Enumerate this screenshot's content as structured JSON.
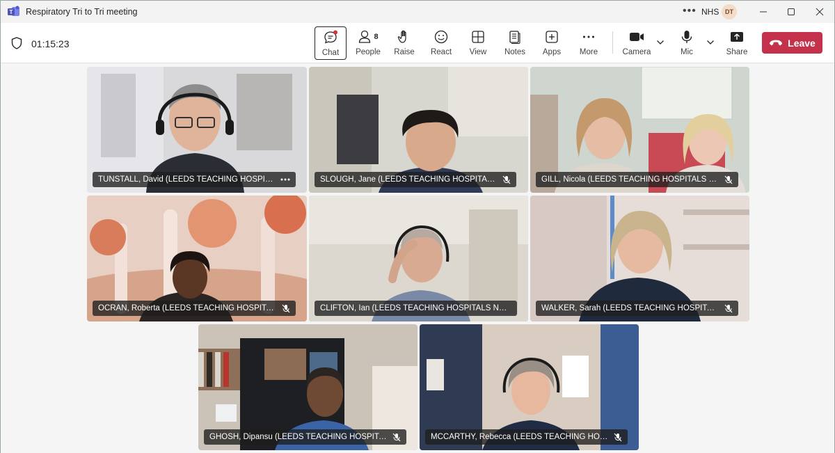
{
  "window": {
    "title": "Respiratory Tri to Tri meeting",
    "org": "NHS",
    "avatar_initials": "DT",
    "more": "•••"
  },
  "toolbar": {
    "timer": "01:15:23",
    "chat": "Chat",
    "people": "People",
    "people_count": "8",
    "raise": "Raise",
    "react": "React",
    "view": "View",
    "notes": "Notes",
    "apps": "Apps",
    "more": "More",
    "camera": "Camera",
    "mic": "Mic",
    "share": "Share",
    "leave": "Leave"
  },
  "colors": {
    "accent": "#5b5fc7",
    "leave": "#c4314b",
    "chat_badge": "#d13438"
  },
  "participants": [
    {
      "name": "TUNSTALL, David (LEEDS TEACHING HOSPITALS N...",
      "indicator": "more-icon"
    },
    {
      "name": "SLOUGH, Jane (LEEDS TEACHING HOSPITALS NHS...",
      "indicator": "mic-muted-icon"
    },
    {
      "name": "GILL, Nicola (LEEDS TEACHING HOSPITALS NHS T...",
      "indicator": "mic-muted-icon"
    },
    {
      "name": "OCRAN, Roberta (LEEDS TEACHING HOSPITALS N...",
      "indicator": "mic-muted-icon"
    },
    {
      "name": "CLIFTON, Ian (LEEDS TEACHING HOSPITALS NHS TRUS...",
      "indicator": "none"
    },
    {
      "name": "WALKER, Sarah (LEEDS TEACHING HOSPITALS NH...",
      "indicator": "mic-muted-icon"
    },
    {
      "name": "GHOSH, Dipansu (LEEDS TEACHING HOSPITALS N...",
      "indicator": "mic-muted-icon"
    },
    {
      "name": "MCCARTHY, Rebecca (LEEDS TEACHING HOSPITA...",
      "indicator": "mic-muted-icon"
    }
  ]
}
